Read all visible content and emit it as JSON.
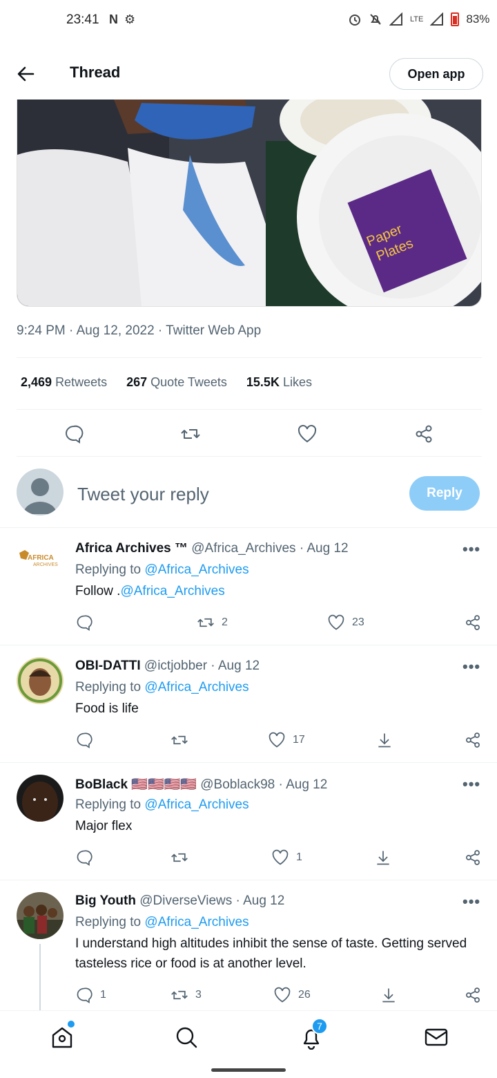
{
  "status_bar": {
    "time": "23:41",
    "left_icons": "N ⚙",
    "network": "LTE",
    "battery": "83%"
  },
  "header": {
    "title": "Thread",
    "open_app": "Open app"
  },
  "tweet": {
    "meta": "9:24 PM · Aug 12, 2022 · Twitter Web App",
    "stats": [
      {
        "count": "2,469",
        "label": "Retweets"
      },
      {
        "count": "267",
        "label": "Quote Tweets"
      },
      {
        "count": "15.5K",
        "label": "Likes"
      }
    ],
    "media_text": {
      "brand": "Paper",
      "line2": "Plates"
    }
  },
  "composer": {
    "placeholder": "Tweet your reply",
    "button": "Reply"
  },
  "replies": [
    {
      "name": "Africa Archives ™",
      "handle": "@Africa_Archives · Aug 12",
      "replying_prefix": "Replying to ",
      "replying_to": "@Africa_Archives",
      "text_prefix": "Follow .",
      "text_link": "@Africa_Archives",
      "avatar_text": "AFRICA ARCHIVES",
      "replies": "",
      "retweets": "2",
      "likes": "23"
    },
    {
      "name": "OBI-DATTI",
      "handle": "@ictjobber · Aug 12",
      "replying_prefix": "Replying to ",
      "replying_to": "@Africa_Archives",
      "text": "Food is life",
      "replies": "",
      "retweets": "",
      "likes": "17"
    },
    {
      "name": "BoBlack",
      "flags": "🇺🇸🇺🇸🇺🇸🇺🇸",
      "handle": "@Boblack98 · Aug 12",
      "replying_prefix": "Replying to ",
      "replying_to": "@Africa_Archives",
      "text": "Major flex",
      "replies": "",
      "retweets": "",
      "likes": "1"
    },
    {
      "name": "Big Youth",
      "handle": "@DiverseViews · Aug 12",
      "replying_prefix": "Replying to ",
      "replying_to": "@Africa_Archives",
      "text": "I understand high altitudes inhibit the sense of taste. Getting served tasteless rice or food is at another level.",
      "replies": "1",
      "retweets": "3",
      "likes": "26"
    }
  ],
  "more_label": "•••",
  "nav": {
    "notifications_badge": "7"
  },
  "colors": {
    "accent": "#1d9bf0",
    "muted": "#536471",
    "reply_button": "#8ecdf8"
  }
}
